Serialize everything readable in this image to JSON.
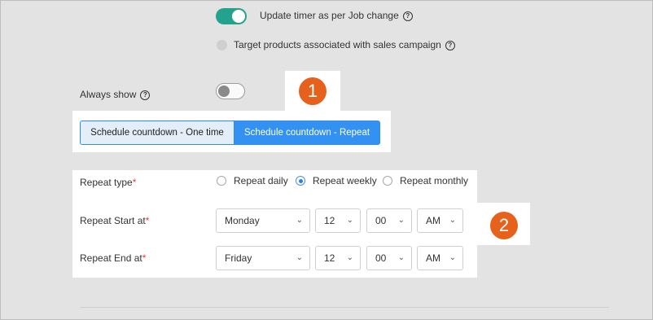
{
  "update_timer": {
    "label": "Update timer as per Job change",
    "enabled": true
  },
  "target_products": {
    "label": "Target products associated with sales campaign"
  },
  "always_show": {
    "label": "Always show",
    "enabled": false
  },
  "schedule_tabs": [
    {
      "label": "Schedule countdown - One time",
      "selected": false
    },
    {
      "label": "Schedule countdown - Repeat",
      "selected": true
    }
  ],
  "badges": [
    "1",
    "2"
  ],
  "repeat_type": {
    "label": "Repeat type",
    "required_mark": "*",
    "options": [
      {
        "label": "Repeat daily",
        "checked": false
      },
      {
        "label": "Repeat weekly",
        "checked": true
      },
      {
        "label": "Repeat monthly",
        "checked": false
      }
    ]
  },
  "repeat_start": {
    "label": "Repeat Start at",
    "required_mark": "*",
    "day": "Monday",
    "hour": "12",
    "minute": "00",
    "ampm": "AM"
  },
  "repeat_end": {
    "label": "Repeat End at",
    "required_mark": "*",
    "day": "Friday",
    "hour": "12",
    "minute": "00",
    "ampm": "AM"
  },
  "icons": {
    "help": "question-circle-icon",
    "dropdown": "chevron-down-icon"
  },
  "colors": {
    "toggle_on": "#23a38d",
    "selected_tab": "#3391f2",
    "badge": "#e6621c",
    "required": "#e53935"
  }
}
